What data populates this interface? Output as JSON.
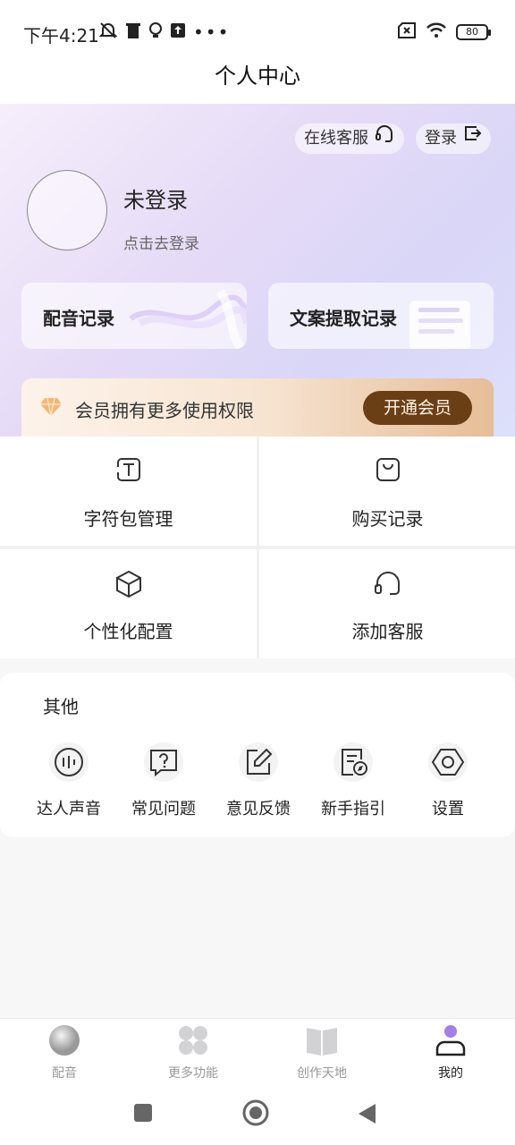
{
  "status_bar": {
    "time": "下午4:21",
    "battery": "80"
  },
  "page_title": "个人中心",
  "header": {
    "online_service": "在线客服",
    "login": "登录",
    "username": "未登录",
    "login_hint": "点击去登录"
  },
  "records": [
    {
      "label": "配音记录"
    },
    {
      "label": "文案提取记录"
    }
  ],
  "vip": {
    "text": "会员拥有更多使用权限",
    "button": "开通会员"
  },
  "grid": [
    {
      "label": "字符包管理",
      "icon": "text-package-icon"
    },
    {
      "label": "购买记录",
      "icon": "shopping-bag-icon"
    },
    {
      "label": "个性化配置",
      "icon": "cube-icon"
    },
    {
      "label": "添加客服",
      "icon": "headset-icon"
    }
  ],
  "other": {
    "title": "其他",
    "items": [
      {
        "label": "达人声音",
        "icon": "voice-icon"
      },
      {
        "label": "常见问题",
        "icon": "question-icon"
      },
      {
        "label": "意见反馈",
        "icon": "edit-feedback-icon"
      },
      {
        "label": "新手指引",
        "icon": "guide-icon"
      },
      {
        "label": "设置",
        "icon": "settings-icon"
      }
    ]
  },
  "tabs": [
    {
      "label": "配音",
      "active": false
    },
    {
      "label": "更多功能",
      "active": false
    },
    {
      "label": "创作天地",
      "active": false
    },
    {
      "label": "我的",
      "active": true
    }
  ],
  "colors": {
    "accent": "#a57ee8",
    "vip_button": "#6b3f16",
    "hero_start": "#f6eefb",
    "hero_end": "#dde0fb"
  }
}
